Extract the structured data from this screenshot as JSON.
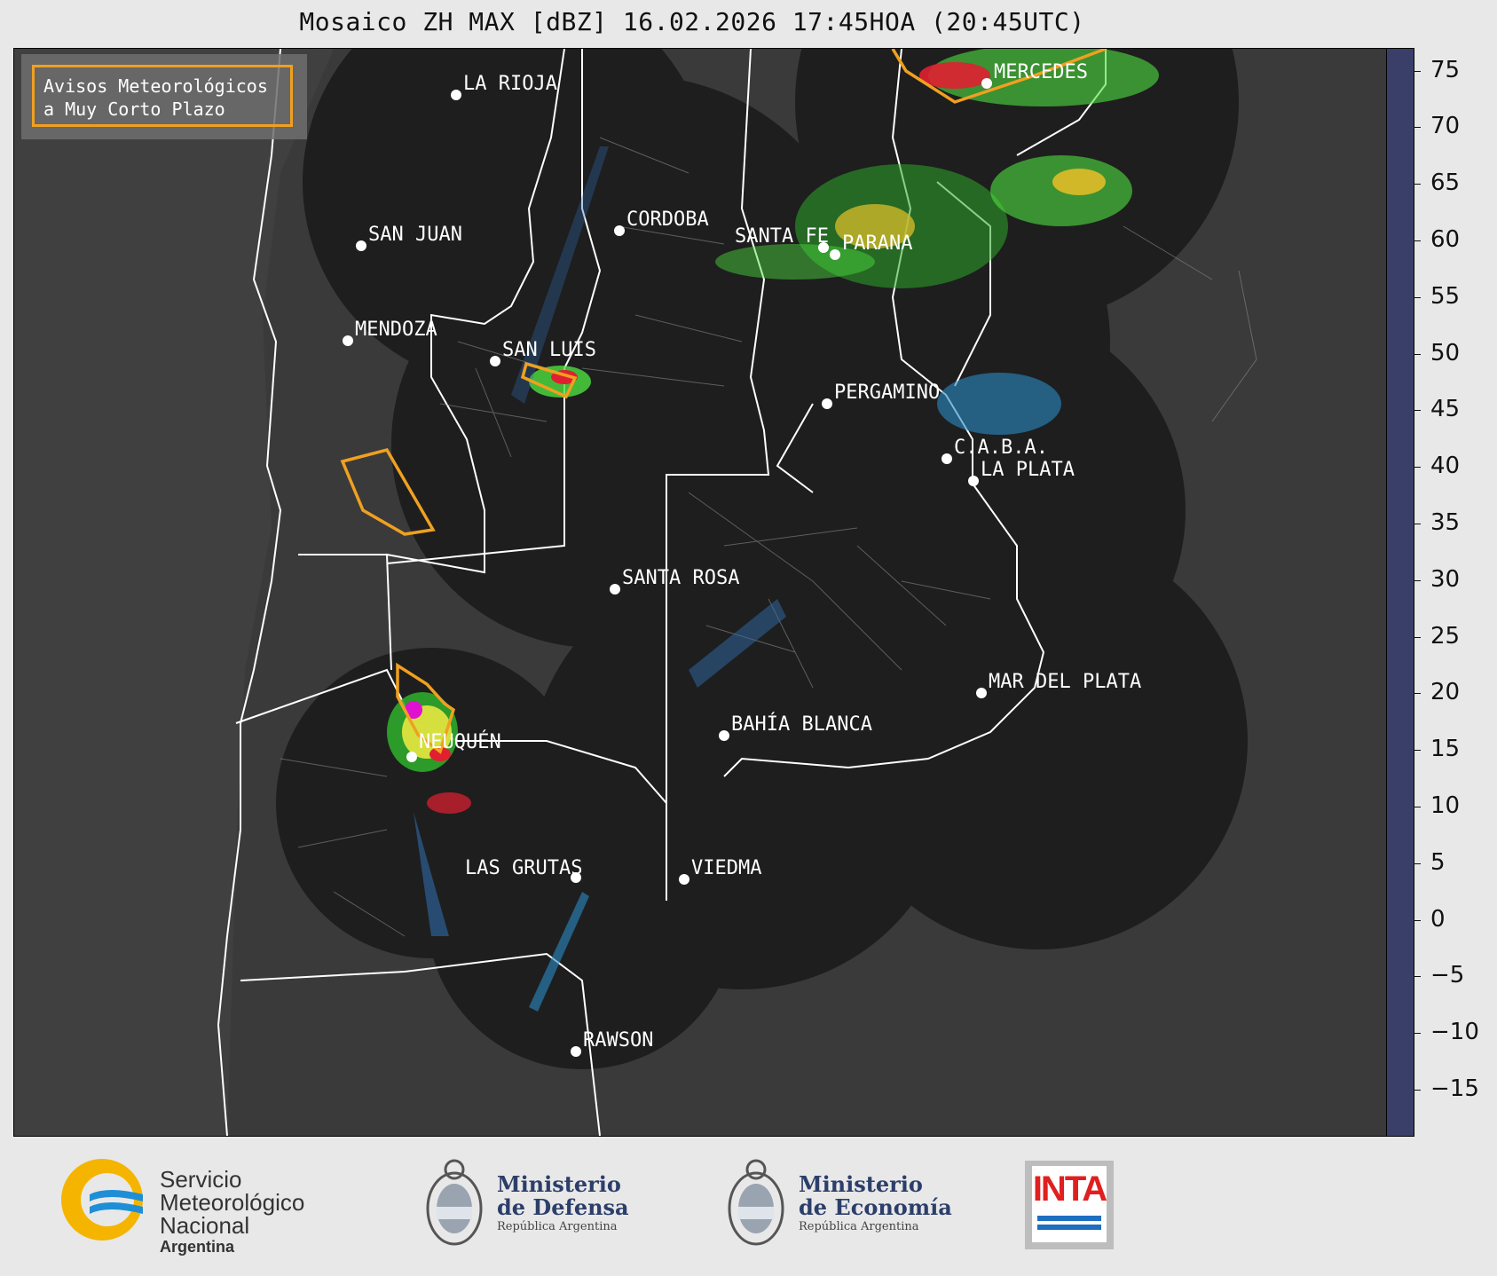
{
  "title": "Mosaico ZH MAX [dBZ] 16.02.2026 17:45HOA (20:45UTC)",
  "legend": {
    "line1": "Avisos Meteorológicos",
    "line2": "a Muy Corto Plazo",
    "border_color": "#f0a020"
  },
  "cities": [
    {
      "name": "LA RIOJA"
    },
    {
      "name": "SAN JUAN"
    },
    {
      "name": "CORDOBA"
    },
    {
      "name": "SANTA FE"
    },
    {
      "name": "PARANA"
    },
    {
      "name": "MENDOZA"
    },
    {
      "name": "SAN LUIS"
    },
    {
      "name": "PERGAMINO"
    },
    {
      "name": "C.A.B.A."
    },
    {
      "name": "LA PLATA"
    },
    {
      "name": "SANTA ROSA"
    },
    {
      "name": "MAR DEL PLATA"
    },
    {
      "name": "BAHÍA BLANCA"
    },
    {
      "name": "NEUQUÉN"
    },
    {
      "name": "LAS GRUTAS"
    },
    {
      "name": "VIEDMA"
    },
    {
      "name": "RAWSON"
    },
    {
      "name": "MERCEDES"
    }
  ],
  "colorbar": {
    "ticks": [
      "75",
      "70",
      "65",
      "60",
      "55",
      "50",
      "45",
      "40",
      "35",
      "30",
      "25",
      "20",
      "15",
      "10",
      "5",
      "0",
      "−5",
      "−10",
      "−15"
    ],
    "range": [
      -19,
      77
    ],
    "stops": [
      {
        "from": -19,
        "color": "#3a3f6a"
      },
      {
        "from": -10,
        "color": "#3c4a80"
      },
      {
        "from": 0,
        "color": "#2f6aa8"
      },
      {
        "from": 10,
        "color": "#2a8ac4"
      },
      {
        "from": 16,
        "color": "#26b0dc"
      },
      {
        "from": 18,
        "color": "#4ee040"
      },
      {
        "from": 22,
        "color": "#2ea82a"
      },
      {
        "from": 27,
        "color": "#1e6e20"
      },
      {
        "from": 30,
        "color": "#e8e840"
      },
      {
        "from": 35,
        "color": "#d0b828"
      },
      {
        "from": 38,
        "color": "#e07a18"
      },
      {
        "from": 42,
        "color": "#e02030"
      },
      {
        "from": 47,
        "color": "#a00010"
      },
      {
        "from": 50,
        "color": "#e0106a"
      },
      {
        "from": 53,
        "color": "#e010d0"
      },
      {
        "from": 56,
        "color": "#9000a0"
      },
      {
        "from": 58,
        "color": "#ffffff"
      },
      {
        "from": 61,
        "color": "#c8f0e0"
      },
      {
        "from": 66,
        "color": "#a8e8cc"
      },
      {
        "from": 70,
        "color": "#88dcbc"
      }
    ]
  },
  "footer": {
    "smn_line1": "Servicio",
    "smn_line2": "Meteorológico",
    "smn_line3": "Nacional",
    "smn_line4": "Argentina",
    "defensa_line1": "Ministerio",
    "defensa_line2": "de Defensa",
    "defensa_line3": "República Argentina",
    "economia_line1": "Ministerio",
    "economia_line2": "de Economía",
    "economia_line3": "República Argentina",
    "inta": "INTA"
  }
}
